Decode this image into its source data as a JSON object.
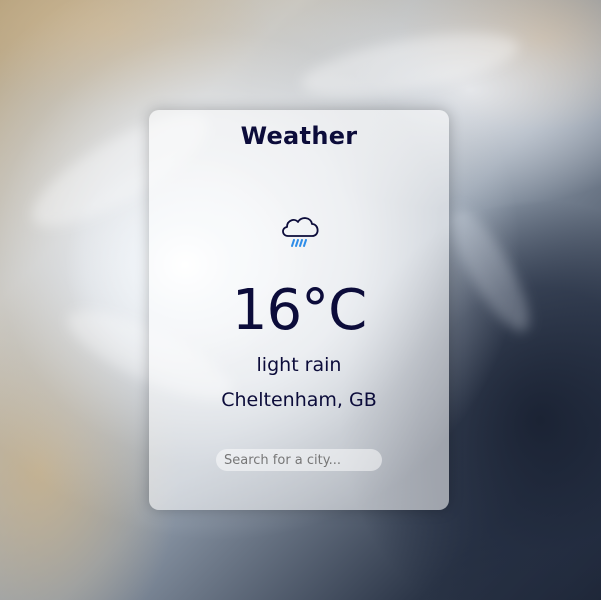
{
  "app": {
    "title": "Weather"
  },
  "weather": {
    "icon": "rain-cloud-icon",
    "temperature": "16°C",
    "description": "light rain",
    "location": "Cheltenham, GB"
  },
  "search": {
    "placeholder": "Search for a city...",
    "value": ""
  },
  "colors": {
    "text": "#0c0c3a",
    "rain": "#2e8de8"
  }
}
